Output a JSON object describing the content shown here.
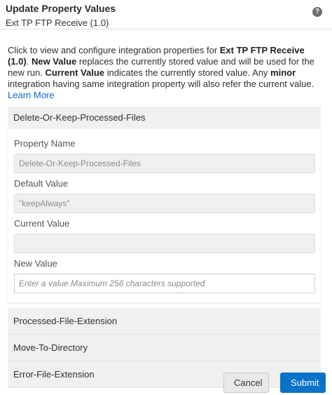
{
  "dialog": {
    "title": "Update Property Values",
    "subtitle": "Ext TP FTP Receive (1.0)",
    "help_icon": "?"
  },
  "intro": {
    "p1": "Click to view and configure integration properties for ",
    "b1": "Ext TP FTP Receive (1.0)",
    "p2": ". ",
    "b2": "New Value",
    "p3": " replaces the currently stored value and will be used for the new run. ",
    "b3": "Current Value",
    "p4": " indicates the currently stored value. Any ",
    "b4": "minor",
    "p5": " integration having same integration property will also refer the current value. ",
    "learn_more": "Learn More"
  },
  "properties": [
    {
      "name": "Delete-Or-Keep-Processed-Files",
      "expanded": true,
      "labels": {
        "property_name": "Property Name",
        "default_value": "Default Value",
        "current_value": "Current Value",
        "new_value": "New Value"
      },
      "property_name_value": "Delete-Or-Keep-Processed-Files",
      "default_value": "\"keepAlways\"",
      "current_value": "",
      "new_value_placeholder": "Enter a value.Maximum 256 characters supported"
    },
    {
      "name": "Processed-File-Extension",
      "expanded": false
    },
    {
      "name": "Move-To-Directory",
      "expanded": false
    },
    {
      "name": "Error-File-Extension",
      "expanded": false
    }
  ],
  "buttons": {
    "cancel": "Cancel",
    "submit": "Submit"
  },
  "colors": {
    "accent": "#0a72c9",
    "link": "#0b6ad0",
    "section_bg": "#f0f0f0"
  }
}
